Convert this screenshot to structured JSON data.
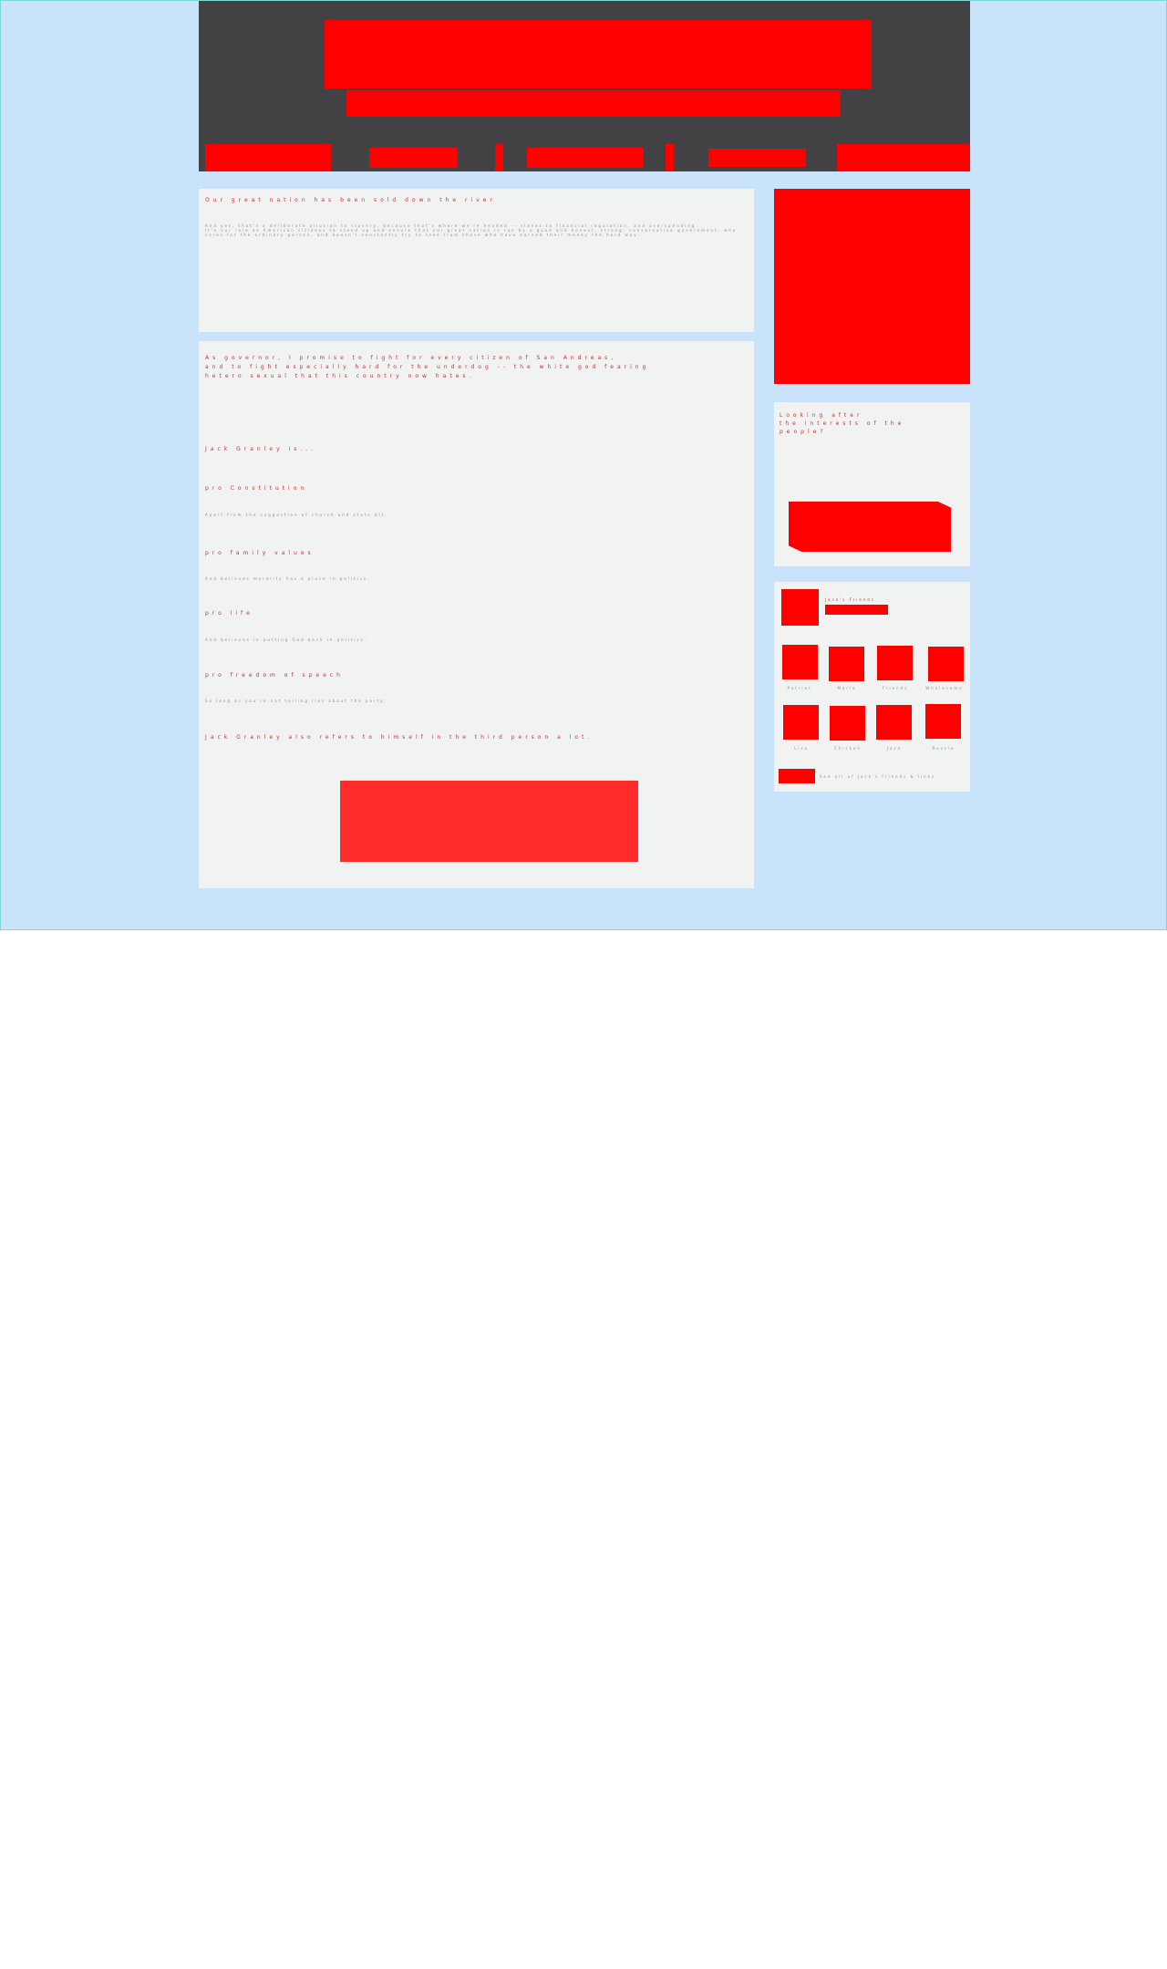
{
  "header": {
    "background": "#424143",
    "nav": {
      "accent": "#ff0000"
    }
  },
  "main": {
    "article1": {
      "title": "Our great nation has been sold down the river",
      "body": "And yes, that's a deliberate allusion to slavery, because that's where we're headed -- slaves to financial regulation, and overspending.\nIt's our role as American citizens to stand up and ensure that our great nation is run by a good and honest, strong, conservative government, who cares for the ordinary person, and doesn't constantly try to take from those who have earned their money the hard way."
    },
    "article2": {
      "intro": "As governor, I promise to fight for every citizen of San Andreas,\nand to fight especially hard for the underdog -- the white god fearing\nhetero sexual that this country now hates.",
      "lead": "Jack Granley is...",
      "positions": [
        {
          "heading": "pro Constitution",
          "detail": "Apart from the suggestion of church and state bit."
        },
        {
          "heading": "pro family values",
          "detail": "And believes morality has a place in politics."
        },
        {
          "heading": "pro life",
          "detail": "And believes in putting God back in politics."
        },
        {
          "heading": "pro freedom of speech",
          "detail": "So long as you're not telling lies about the party."
        }
      ],
      "closing": "Jack Granley also refers to himself in the third person a lot."
    }
  },
  "sidebar": {
    "poll": {
      "title": "Looking after\nthe interests of the\npeople?"
    },
    "friends": {
      "heading": "Jack's Friends",
      "row1_labels": [
        "Patriot",
        "Marie",
        "Friends",
        "Wholesome"
      ],
      "row2_labels": [
        "Lisa",
        "Chicken",
        "Jace",
        "Bessie"
      ],
      "footer": "See all of Jack's friends & links"
    }
  }
}
